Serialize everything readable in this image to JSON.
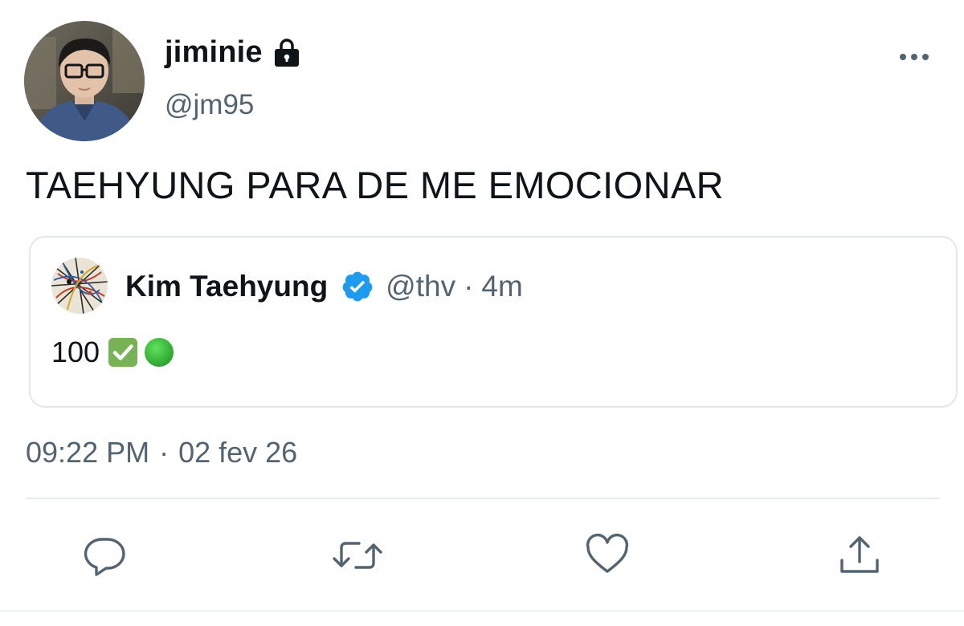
{
  "author": {
    "display_name": "jiminie",
    "handle": "@jm95",
    "avatar_icon": "profile-photo",
    "protected_icon": "lock-icon"
  },
  "tweet": {
    "text": "TAEHYUNG PARA DE ME EMOCIONAR",
    "timestamp_time": "09:22 PM",
    "timestamp_sep": "·",
    "timestamp_date": "02 fev 26"
  },
  "quoted_tweet": {
    "display_name": "Kim Taehyung",
    "handle": "@thv",
    "separator": "·",
    "time_ago": "4m",
    "verified_icon": "verified-badge-icon",
    "body_text": "100",
    "emojis": [
      "check-mark-button-emoji",
      "green-circle-emoji"
    ]
  },
  "actions": {
    "reply_icon": "reply-icon",
    "retweet_icon": "retweet-icon",
    "like_icon": "heart-icon",
    "share_icon": "share-icon",
    "more_icon": "more-dots-icon"
  },
  "colors": {
    "primary_text": "#0f1419",
    "secondary_text": "#536471",
    "verified_blue": "#1d9bf0",
    "border": "#e3e7ea",
    "check_green": "#77b255",
    "circle_green": "#3fbf3f"
  }
}
